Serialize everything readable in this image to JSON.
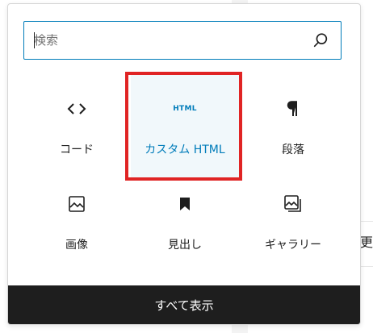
{
  "search": {
    "placeholder": "検索",
    "value": ""
  },
  "blocks": [
    {
      "label": "コード",
      "icon": "code-icon"
    },
    {
      "label": "カスタム HTML",
      "icon": "html-icon",
      "icon_text": "HTML",
      "selected": true
    },
    {
      "label": "段落",
      "icon": "paragraph-icon"
    },
    {
      "label": "画像",
      "icon": "image-icon"
    },
    {
      "label": "見出し",
      "icon": "bookmark-icon"
    },
    {
      "label": "ギャラリー",
      "icon": "gallery-icon"
    }
  ],
  "footer": {
    "label": "すべて表示"
  },
  "background": {
    "edge_text": "更新"
  },
  "colors": {
    "accent": "#007cba",
    "highlight_border": "#e02424",
    "selected_bg": "#f1f8fb",
    "footer_bg": "#1e1e1e"
  }
}
